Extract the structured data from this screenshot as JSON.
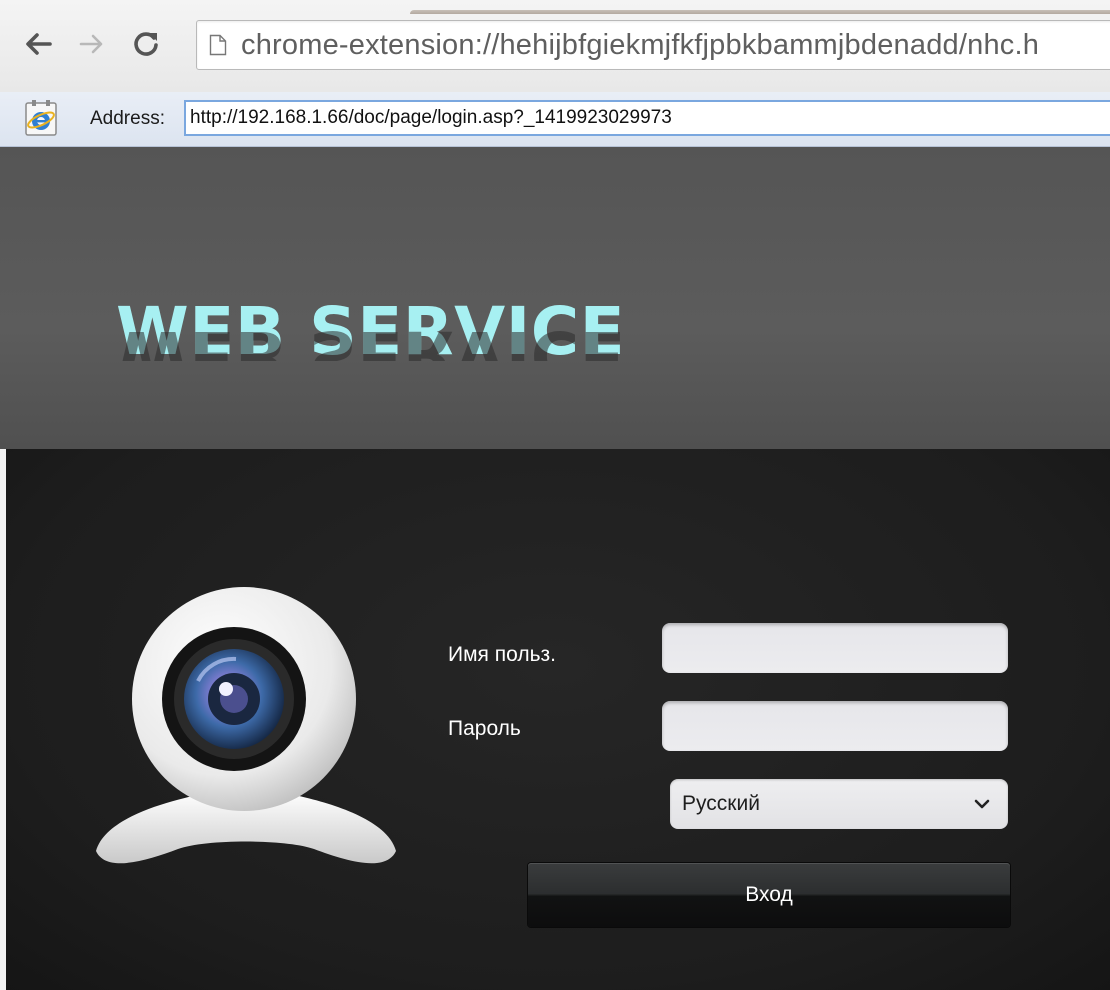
{
  "browser": {
    "url": "chrome-extension://hehijbfgiekmjfkfjpbkbammjbdenadd/nhc.h"
  },
  "ie_tab": {
    "address_label": "Address:",
    "address_value": "http://192.168.1.66/doc/page/login.asp?_1419923029973"
  },
  "header": {
    "brand": "WEB SERVICE"
  },
  "login": {
    "username_label": "Имя польз.",
    "username_value": "",
    "password_label": "Пароль",
    "password_value": "",
    "language_selected": "Русский",
    "submit_label": "Вход"
  },
  "icons": {
    "back": "back-arrow-icon",
    "forward": "forward-arrow-icon",
    "reload": "reload-icon",
    "page": "page-icon",
    "ie": "internet-explorer-icon",
    "dropdown": "chevron-down-icon",
    "webcam": "webcam-icon"
  },
  "colors": {
    "brand_text": "#a7f0f2",
    "header_bg": "#575757",
    "login_bg": "#1d1d1d",
    "button_bg": "#1a1b1c",
    "input_bg": "#e8e8eb"
  }
}
